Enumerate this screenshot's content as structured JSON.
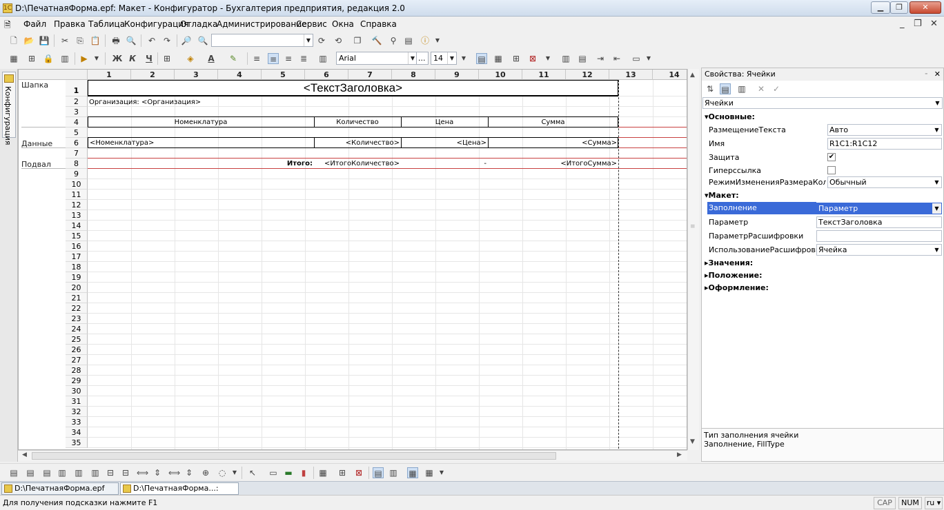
{
  "window": {
    "title": "D:\\ПечатнаяФорма.epf: Макет - Конфигуратор - Бухгалтерия предприятия, редакция 2.0"
  },
  "menu": [
    "Файл",
    "Правка",
    "Таблица",
    "Конфигурация",
    "Отладка",
    "Администрирование",
    "Сервис",
    "Окна",
    "Справка"
  ],
  "format": {
    "font": "Arial",
    "ellipsis": "...",
    "size": "14"
  },
  "left_panel": {
    "tab_label": "Конфигурация"
  },
  "sheet": {
    "columns": [
      "1",
      "2",
      "3",
      "4",
      "5",
      "6",
      "7",
      "8",
      "9",
      "10",
      "11",
      "12",
      "13",
      "14"
    ],
    "rows": [
      "1",
      "2",
      "3",
      "4",
      "5",
      "6",
      "7",
      "8",
      "9",
      "10",
      "11",
      "12",
      "13",
      "14",
      "15",
      "16",
      "17",
      "18",
      "19",
      "20",
      "21",
      "22",
      "23",
      "24",
      "25",
      "26",
      "27",
      "28",
      "29",
      "30",
      "31",
      "32",
      "33",
      "34",
      "35"
    ],
    "groups": {
      "header": "Шапка",
      "data": "Данные",
      "footer": "Подвал"
    },
    "title_cell": "<ТекстЗаголовка>",
    "org_label": "Организация:",
    "org_value": "<Организация>",
    "col_headers": {
      "nomenclature": "Номенклатура",
      "quantity": "Количество",
      "price": "Цена",
      "sum": "Сумма"
    },
    "data_row": {
      "nomenclature": "<Номенклатура>",
      "quantity": "<Количество>",
      "price": "<Цена>",
      "sum": "<Сумма>"
    },
    "footer_row": {
      "total_label": "Итого:",
      "quantity": "<ИтогоКоличество>",
      "price": "-",
      "sum": "<ИтогоСумма>"
    }
  },
  "properties": {
    "title": "Свойства: Ячейки",
    "object": "Ячейки",
    "sections": {
      "main": "Основные:",
      "layout": "Макет:",
      "values": "Значения:",
      "position": "Положение:",
      "design": "Оформление:"
    },
    "main": [
      {
        "key": "РазмещениеТекста",
        "value": "Авто"
      },
      {
        "key": "Имя",
        "value": "R1C1:R1C12"
      },
      {
        "key": "Защита",
        "value": "✔"
      },
      {
        "key": "Гиперссылка",
        "value": ""
      },
      {
        "key": "РежимИзмененияРазмераКолонки",
        "value": "Обычный"
      }
    ],
    "layout": [
      {
        "key": "Заполнение",
        "value": "Параметр"
      },
      {
        "key": "Параметр",
        "value": "ТекстЗаголовка"
      },
      {
        "key": "ПараметрРасшифровки",
        "value": ""
      },
      {
        "key": "ИспользованиеРасшифровки",
        "value": "Ячейка"
      }
    ],
    "description": {
      "line1": "Тип заполнения ячейки",
      "line2": "Заполнение, FillType"
    }
  },
  "window_tabs": [
    {
      "label": "D:\\ПечатнаяФорма.epf"
    },
    {
      "label": "D:\\ПечатнаяФорма...: Макет"
    }
  ],
  "status": {
    "hint": "Для получения подсказки нажмите F1",
    "cap": "CAP",
    "num": "NUM",
    "lang": "ru"
  }
}
